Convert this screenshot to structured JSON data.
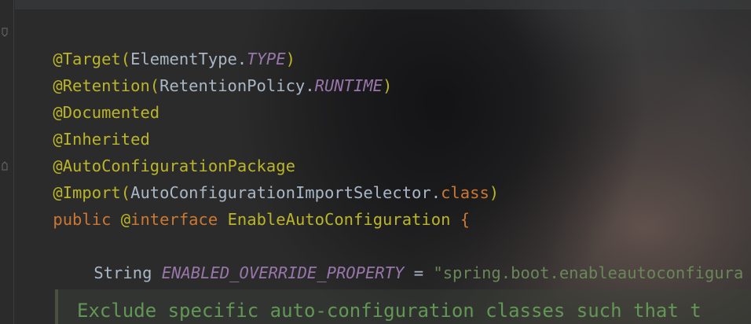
{
  "editor": {
    "lines": [
      {
        "annotation": "@Target",
        "open": "(",
        "type": "ElementType.",
        "constant": "TYPE",
        "close": ")"
      },
      {
        "annotation": "@Retention",
        "open": "(",
        "type": "RetentionPolicy.",
        "constant": "RUNTIME",
        "close": ")"
      },
      {
        "annotation": "@Documented"
      },
      {
        "annotation": "@Inherited"
      },
      {
        "annotation": "@AutoConfigurationPackage"
      },
      {
        "annotation": "@Import",
        "open": "(",
        "type": "AutoConfigurationImportSelector.",
        "keyword": "class",
        "close": ")"
      }
    ],
    "declaration": {
      "modifier": "public",
      "at": "@",
      "keyword": "interface",
      "name": "EnableAutoConfiguration",
      "brace": "{"
    },
    "field": {
      "type": "String",
      "name": "ENABLED_OVERRIDE_PROPERTY",
      "equals": "=",
      "value": "\"spring.boot.enableautoconfigura"
    },
    "doc": {
      "text": "Exclude specific auto-configuration classes such that t"
    }
  },
  "icons": {
    "fold_marker": "fold-marker-icon"
  },
  "colors": {
    "background": "#2b2b2b",
    "annotation": "#bbb529",
    "keyword": "#cc7832",
    "static_field": "#9876aa",
    "string": "#6a8759",
    "plain": "#a9b7c6",
    "doc_comment": "#629755"
  }
}
